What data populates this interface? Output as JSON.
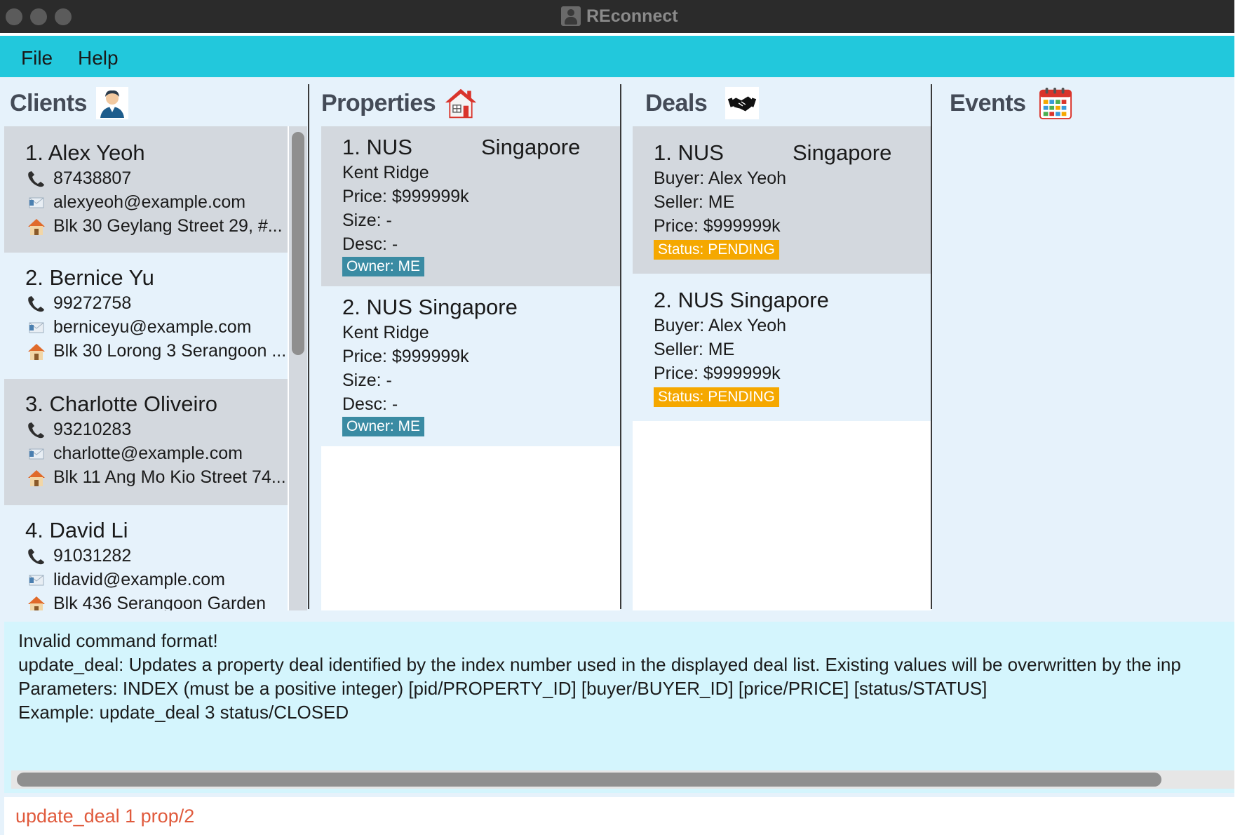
{
  "window": {
    "title": "REconnect"
  },
  "menu": {
    "items": [
      "File",
      "Help"
    ]
  },
  "panels": {
    "clients": {
      "title": "Clients",
      "icon": "person-icon",
      "items": [
        {
          "name": "1. Alex Yeoh",
          "phone": "87438807",
          "email": "alexyeoh@example.com",
          "address": "Blk 30 Geylang Street 29, #..."
        },
        {
          "name": "2. Bernice Yu",
          "phone": "99272758",
          "email": "berniceyu@example.com",
          "address": "Blk 30 Lorong 3 Serangoon ..."
        },
        {
          "name": "3. Charlotte Oliveiro",
          "phone": "93210283",
          "email": "charlotte@example.com",
          "address": "Blk 11 Ang Mo Kio Street 74..."
        },
        {
          "name": "4. David Li",
          "phone": "91031282",
          "email": "lidavid@example.com",
          "address": "Blk 436 Serangoon Garden"
        }
      ]
    },
    "properties": {
      "title": "Properties",
      "icon": "house-icon",
      "items": [
        {
          "name_left": "1. NUS",
          "name_right": "Singapore",
          "location": "Kent Ridge",
          "price": "Price: $999999k",
          "size": "Size: -",
          "desc": "Desc: -",
          "owner": "Owner: ME"
        },
        {
          "name_left": "2. NUS Singapore",
          "name_right": "",
          "location": "Kent Ridge",
          "price": "Price: $999999k",
          "size": "Size: -",
          "desc": "Desc: -",
          "owner": "Owner: ME"
        }
      ]
    },
    "deals": {
      "title": "Deals",
      "icon": "handshake-icon",
      "items": [
        {
          "name_left": "1. NUS",
          "name_right": "Singapore",
          "buyer": "Buyer: Alex Yeoh",
          "seller": "Seller: ME",
          "price": "Price: $999999k",
          "status": "Status: PENDING"
        },
        {
          "name_left": "2. NUS Singapore",
          "name_right": "",
          "buyer": "Buyer: Alex Yeoh",
          "seller": "Seller: ME",
          "price": "Price: $999999k",
          "status": "Status: PENDING"
        }
      ]
    },
    "events": {
      "title": "Events",
      "icon": "calendar-icon",
      "items": []
    }
  },
  "result": {
    "lines": [
      "Invalid command format!",
      "update_deal: Updates a property deal identified by the index number used in the displayed deal list. Existing values will be overwritten by the inp",
      "Parameters: INDEX (must be a positive integer) [pid/PROPERTY_ID] [buyer/BUYER_ID] [price/PRICE] [status/STATUS]",
      "Example: update_deal 3 status/CLOSED"
    ]
  },
  "command": {
    "value": "update_deal 1 prop/2"
  },
  "colors": {
    "menubar": "#22c8dc",
    "selected_card": "#d3d8de",
    "owner_tag": "#3a8ba3",
    "status_tag": "#f5a800",
    "command_text": "#e05a3c",
    "result_bg": "#d4f5fd"
  }
}
